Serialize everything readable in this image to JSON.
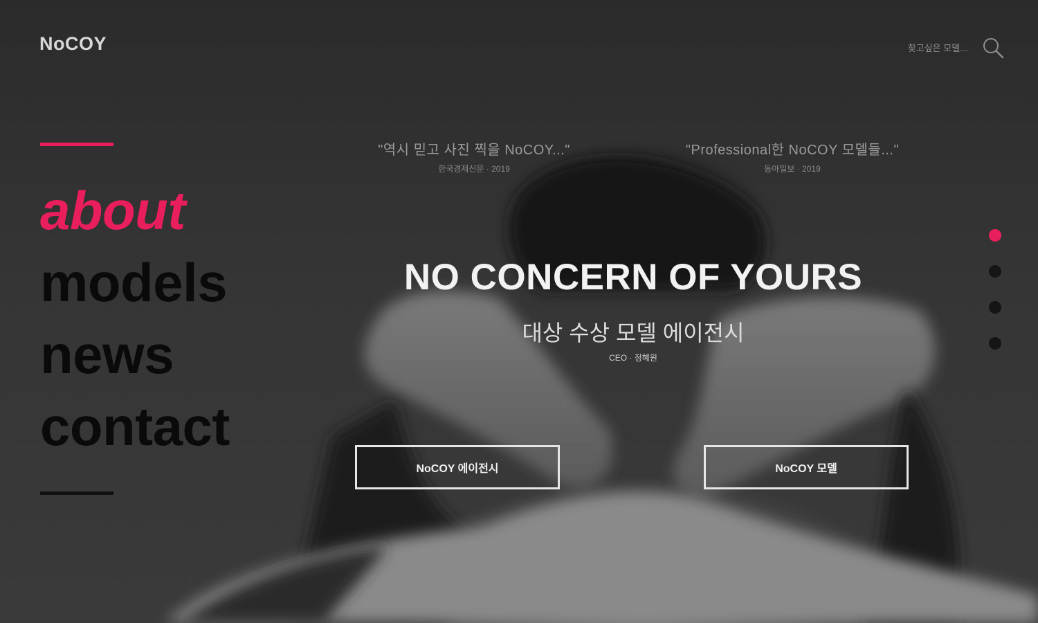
{
  "header": {
    "logo": "NoCOY",
    "search_placeholder": "찾고싶은 모델..."
  },
  "nav": {
    "items": [
      {
        "label": "about",
        "active": true
      },
      {
        "label": "models",
        "active": false
      },
      {
        "label": "news",
        "active": false
      },
      {
        "label": "contact",
        "active": false
      }
    ]
  },
  "quotes": [
    {
      "text": "\"역시 믿고 사진 찍을 NoCOY...\"",
      "source": "한국경제신문 · 2019"
    },
    {
      "text": "\"Professional한 NoCOY 모델들...\"",
      "source": "동아일보 · 2019"
    }
  ],
  "hero": {
    "title": "NO CONCERN OF YOURS",
    "subtitle": "대상 수상 모델 에이전시",
    "caption": "CEO · 정혜원",
    "button_primary": "NoCOY 에이전시",
    "button_secondary": "NoCOY 모델"
  },
  "slider": {
    "count": 4,
    "active_index": 0
  },
  "colors": {
    "accent": "#e91e5c",
    "background": "#2f2f2f",
    "nav_text": "#0a0a0a"
  }
}
